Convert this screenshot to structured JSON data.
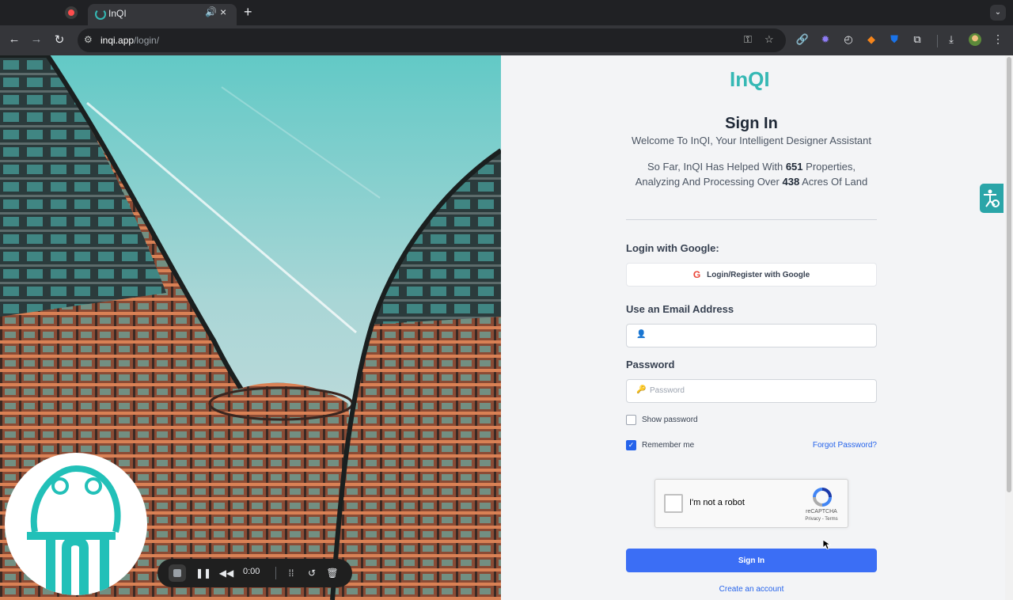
{
  "browser": {
    "tab_title": "InQI",
    "url_host": "inqi.app",
    "url_path": "/login/",
    "accent": "#35b8b4"
  },
  "page": {
    "logo_text": "InQI",
    "title": "Sign In",
    "welcome": "Welcome To InQI, Your Intelligent Designer Assistant",
    "stats_prefix": "So Far, InQI Has Helped With",
    "properties_count": "651",
    "stats_middle": "Properties,",
    "stats_line2_prefix": "Analyzing And Processing Over",
    "acres_count": "438",
    "stats_suffix": "Acres Of Land",
    "google_label": "Login with Google:",
    "google_button": "Login/Register with Google",
    "email_label": "Use an Email Address",
    "email_value": "",
    "password_label": "Password",
    "password_placeholder": "Password",
    "show_password": "Show password",
    "show_password_checked": false,
    "remember_me": "Remember me",
    "remember_me_checked": true,
    "forgot_password": "Forgot Password?",
    "recaptcha_label": "I'm not a robot",
    "recaptcha_brand": "reCAPTCHA",
    "recaptcha_terms": "Privacy - Terms",
    "sign_in_button": "Sign In",
    "create_account": "Create an account",
    "primary_color": "#3b6ef5",
    "link_color": "#2563eb"
  },
  "recorder": {
    "time": "0:00"
  }
}
